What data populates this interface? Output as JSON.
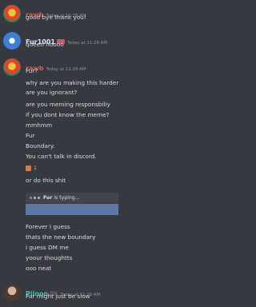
{
  "messages": [
    {
      "user": "rawb",
      "timestamp": "Today at 11:28 AM",
      "lines": [
        "good bye thank you!"
      ]
    },
    {
      "user": "Fur1001",
      "timestamp": "Today at 11:28 AM",
      "lines": [
        "queen noooo"
      ]
    },
    {
      "user": "rawb",
      "timestamp": "Today at 11:28 AM",
      "lines": [
        "Fur?",
        "why are you making this harder",
        "are you ignorant?",
        "are you meming responsbiliy",
        "if you dont know the meme?",
        "mmhmm",
        "Fur",
        "Boundary.",
        "You can't talk in discord."
      ],
      "reaction_count": "1",
      "after_reaction": [
        "or do this shit"
      ],
      "typing_indicator": {
        "name": "Fur",
        "suffix": " is typing..."
      },
      "after_typing": [
        "Forever I guess",
        "thats the new boundary",
        "i guess DM me",
        "yoour thoughtts",
        "ooo neat"
      ]
    },
    {
      "user": "Pjinon",
      "timestamp": "Today at 11:29 AM",
      "lines": [
        "Fur might just be slow"
      ]
    }
  ],
  "colors": {
    "background": "#36393f",
    "rawb": "#e05656",
    "fur": "#dde3ff",
    "pjinon": "#3fc0a6",
    "text": "#dcddde",
    "timestamp": "#8e9297"
  }
}
